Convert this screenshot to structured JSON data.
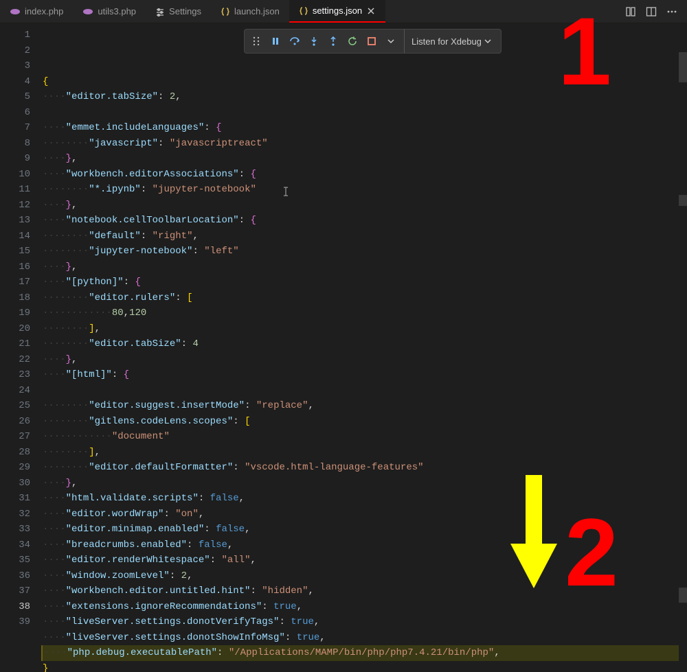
{
  "tabs": [
    {
      "label": "index.php",
      "icon": "php",
      "active": false,
      "close": false
    },
    {
      "label": "utils3.php",
      "icon": "php",
      "active": false,
      "close": false
    },
    {
      "label": "Settings",
      "icon": "settings",
      "active": false,
      "close": false
    },
    {
      "label": "launch.json",
      "icon": "json",
      "active": false,
      "close": false
    },
    {
      "label": "settings.json",
      "icon": "json",
      "active": true,
      "close": true
    }
  ],
  "tabbar_right_icons": [
    "compare-icon",
    "split-editor-icon",
    "more-icon"
  ],
  "debug_toolbar": {
    "tools": [
      "drag-handle-icon",
      "pause-icon",
      "step-over-icon",
      "step-into-icon",
      "step-out-icon",
      "restart-icon",
      "stop-icon",
      "chevron-down-icon"
    ],
    "listen_label": "Listen for Xdebug"
  },
  "line_numbers": {
    "start": 1,
    "end": 39,
    "current": 38
  },
  "annotations": {
    "one": "1",
    "two": "2"
  },
  "settings_json": {
    "editor.tabSize": 2,
    "emmet.includeLanguages": {
      "javascript": "javascriptreact"
    },
    "workbench.editorAssociations": {
      "*.ipynb": "jupyter-notebook"
    },
    "notebook.cellToolbarLocation": {
      "default": "right",
      "jupyter-notebook": "left"
    },
    "[python]": {
      "editor.rulers": [
        80,
        120
      ],
      "editor.tabSize": 4
    },
    "[html]": {
      "editor.suggest.insertMode": "replace",
      "gitlens.codeLens.scopes": [
        "document"
      ],
      "editor.defaultFormatter": "vscode.html-language-features"
    },
    "html.validate.scripts": false,
    "editor.wordWrap": "on",
    "editor.minimap.enabled": false,
    "breadcrumbs.enabled": false,
    "editor.renderWhitespace": "all",
    "window.zoomLevel": 2,
    "workbench.editor.untitled.hint": "hidden",
    "extensions.ignoreRecommendations": true,
    "liveServer.settings.donotVerifyTags": true,
    "liveServer.settings.donotShowInfoMsg": true,
    "php.debug.executablePath": "/Applications/MAMP/bin/php/php7.4.21/bin/php"
  },
  "code_lines": [
    [
      {
        "t": "br",
        "v": "{"
      }
    ],
    [
      {
        "t": "ws",
        "v": "····"
      },
      {
        "t": "key",
        "v": "\"editor.tabSize\""
      },
      {
        "t": "pun",
        "v": ": "
      },
      {
        "t": "num",
        "v": "2"
      },
      {
        "t": "pun",
        "v": ","
      }
    ],
    [],
    [
      {
        "t": "ws",
        "v": "····"
      },
      {
        "t": "key",
        "v": "\"emmet.includeLanguages\""
      },
      {
        "t": "pun",
        "v": ": "
      },
      {
        "t": "brp",
        "v": "{"
      }
    ],
    [
      {
        "t": "ws",
        "v": "········"
      },
      {
        "t": "key",
        "v": "\"javascript\""
      },
      {
        "t": "pun",
        "v": ": "
      },
      {
        "t": "str",
        "v": "\"javascriptreact\""
      }
    ],
    [
      {
        "t": "ws",
        "v": "····"
      },
      {
        "t": "brp",
        "v": "}"
      },
      {
        "t": "pun",
        "v": ","
      }
    ],
    [
      {
        "t": "ws",
        "v": "····"
      },
      {
        "t": "key",
        "v": "\"workbench.editorAssociations\""
      },
      {
        "t": "pun",
        "v": ": "
      },
      {
        "t": "brp",
        "v": "{"
      }
    ],
    [
      {
        "t": "ws",
        "v": "········"
      },
      {
        "t": "key",
        "v": "\"*.ipynb\""
      },
      {
        "t": "pun",
        "v": ": "
      },
      {
        "t": "str",
        "v": "\"jupyter-notebook\""
      }
    ],
    [
      {
        "t": "ws",
        "v": "····"
      },
      {
        "t": "brp",
        "v": "}"
      },
      {
        "t": "pun",
        "v": ","
      }
    ],
    [
      {
        "t": "ws",
        "v": "····"
      },
      {
        "t": "key",
        "v": "\"notebook.cellToolbarLocation\""
      },
      {
        "t": "pun",
        "v": ": "
      },
      {
        "t": "brp",
        "v": "{"
      }
    ],
    [
      {
        "t": "ws",
        "v": "········"
      },
      {
        "t": "key",
        "v": "\"default\""
      },
      {
        "t": "pun",
        "v": ": "
      },
      {
        "t": "str",
        "v": "\"right\""
      },
      {
        "t": "pun",
        "v": ","
      }
    ],
    [
      {
        "t": "ws",
        "v": "········"
      },
      {
        "t": "key",
        "v": "\"jupyter-notebook\""
      },
      {
        "t": "pun",
        "v": ": "
      },
      {
        "t": "str",
        "v": "\"left\""
      }
    ],
    [
      {
        "t": "ws",
        "v": "····"
      },
      {
        "t": "brp",
        "v": "}"
      },
      {
        "t": "pun",
        "v": ","
      }
    ],
    [
      {
        "t": "ws",
        "v": "····"
      },
      {
        "t": "key",
        "v": "\"[python]\""
      },
      {
        "t": "pun",
        "v": ": "
      },
      {
        "t": "brp",
        "v": "{"
      }
    ],
    [
      {
        "t": "ws",
        "v": "········"
      },
      {
        "t": "key",
        "v": "\"editor.rulers\""
      },
      {
        "t": "pun",
        "v": ": "
      },
      {
        "t": "br",
        "v": "["
      }
    ],
    [
      {
        "t": "ws",
        "v": "············"
      },
      {
        "t": "num",
        "v": "80"
      },
      {
        "t": "pun",
        "v": ","
      },
      {
        "t": "num",
        "v": "120"
      }
    ],
    [
      {
        "t": "ws",
        "v": "········"
      },
      {
        "t": "br",
        "v": "]"
      },
      {
        "t": "pun",
        "v": ","
      }
    ],
    [
      {
        "t": "ws",
        "v": "········"
      },
      {
        "t": "key",
        "v": "\"editor.tabSize\""
      },
      {
        "t": "pun",
        "v": ": "
      },
      {
        "t": "num",
        "v": "4"
      }
    ],
    [
      {
        "t": "ws",
        "v": "····"
      },
      {
        "t": "brp",
        "v": "}"
      },
      {
        "t": "pun",
        "v": ","
      }
    ],
    [
      {
        "t": "ws",
        "v": "····"
      },
      {
        "t": "key",
        "v": "\"[html]\""
      },
      {
        "t": "pun",
        "v": ": "
      },
      {
        "t": "brp",
        "v": "{"
      }
    ],
    [],
    [
      {
        "t": "ws",
        "v": "········"
      },
      {
        "t": "key",
        "v": "\"editor.suggest.insertMode\""
      },
      {
        "t": "pun",
        "v": ": "
      },
      {
        "t": "str",
        "v": "\"replace\""
      },
      {
        "t": "pun",
        "v": ","
      }
    ],
    [
      {
        "t": "ws",
        "v": "········"
      },
      {
        "t": "key",
        "v": "\"gitlens.codeLens.scopes\""
      },
      {
        "t": "pun",
        "v": ": "
      },
      {
        "t": "br",
        "v": "["
      }
    ],
    [
      {
        "t": "ws",
        "v": "············"
      },
      {
        "t": "str",
        "v": "\"document\""
      }
    ],
    [
      {
        "t": "ws",
        "v": "········"
      },
      {
        "t": "br",
        "v": "]"
      },
      {
        "t": "pun",
        "v": ","
      }
    ],
    [
      {
        "t": "ws",
        "v": "········"
      },
      {
        "t": "key",
        "v": "\"editor.defaultFormatter\""
      },
      {
        "t": "pun",
        "v": ": "
      },
      {
        "t": "str",
        "v": "\"vscode.html-language-features\""
      }
    ],
    [
      {
        "t": "ws",
        "v": "····"
      },
      {
        "t": "brp",
        "v": "}"
      },
      {
        "t": "pun",
        "v": ","
      }
    ],
    [
      {
        "t": "ws",
        "v": "····"
      },
      {
        "t": "key",
        "v": "\"html.validate.scripts\""
      },
      {
        "t": "pun",
        "v": ": "
      },
      {
        "t": "bool",
        "v": "false"
      },
      {
        "t": "pun",
        "v": ","
      }
    ],
    [
      {
        "t": "ws",
        "v": "····"
      },
      {
        "t": "key",
        "v": "\"editor.wordWrap\""
      },
      {
        "t": "pun",
        "v": ": "
      },
      {
        "t": "str",
        "v": "\"on\""
      },
      {
        "t": "pun",
        "v": ","
      }
    ],
    [
      {
        "t": "ws",
        "v": "····"
      },
      {
        "t": "key",
        "v": "\"editor.minimap.enabled\""
      },
      {
        "t": "pun",
        "v": ": "
      },
      {
        "t": "bool",
        "v": "false"
      },
      {
        "t": "pun",
        "v": ","
      }
    ],
    [
      {
        "t": "ws",
        "v": "····"
      },
      {
        "t": "key",
        "v": "\"breadcrumbs.enabled\""
      },
      {
        "t": "pun",
        "v": ": "
      },
      {
        "t": "bool",
        "v": "false"
      },
      {
        "t": "pun",
        "v": ","
      }
    ],
    [
      {
        "t": "ws",
        "v": "····"
      },
      {
        "t": "key",
        "v": "\"editor.renderWhitespace\""
      },
      {
        "t": "pun",
        "v": ": "
      },
      {
        "t": "str",
        "v": "\"all\""
      },
      {
        "t": "pun",
        "v": ","
      }
    ],
    [
      {
        "t": "ws",
        "v": "····"
      },
      {
        "t": "key",
        "v": "\"window.zoomLevel\""
      },
      {
        "t": "pun",
        "v": ": "
      },
      {
        "t": "num",
        "v": "2"
      },
      {
        "t": "pun",
        "v": ","
      }
    ],
    [
      {
        "t": "ws",
        "v": "····"
      },
      {
        "t": "key",
        "v": "\"workbench.editor.untitled.hint\""
      },
      {
        "t": "pun",
        "v": ": "
      },
      {
        "t": "str",
        "v": "\"hidden\""
      },
      {
        "t": "pun",
        "v": ","
      }
    ],
    [
      {
        "t": "ws",
        "v": "····"
      },
      {
        "t": "key",
        "v": "\"extensions.ignoreRecommendations\""
      },
      {
        "t": "pun",
        "v": ": "
      },
      {
        "t": "bool",
        "v": "true"
      },
      {
        "t": "pun",
        "v": ","
      }
    ],
    [
      {
        "t": "ws",
        "v": "····"
      },
      {
        "t": "key",
        "v": "\"liveServer.settings.donotVerifyTags\""
      },
      {
        "t": "pun",
        "v": ": "
      },
      {
        "t": "bool",
        "v": "true"
      },
      {
        "t": "pun",
        "v": ","
      }
    ],
    [
      {
        "t": "ws",
        "v": "····"
      },
      {
        "t": "key",
        "v": "\"liveServer.settings.donotShowInfoMsg\""
      },
      {
        "t": "pun",
        "v": ": "
      },
      {
        "t": "bool",
        "v": "true"
      },
      {
        "t": "pun",
        "v": ","
      }
    ],
    [
      {
        "t": "ws",
        "v": "····"
      },
      {
        "t": "key",
        "v": "\"php.debug.executablePath\""
      },
      {
        "t": "pun",
        "v": ": "
      },
      {
        "t": "str",
        "v": "\"/Applications/MAMP/bin/php/php7.4.21/bin/php\""
      },
      {
        "t": "pun",
        "v": ","
      }
    ],
    [
      {
        "t": "br",
        "v": "}"
      }
    ]
  ]
}
